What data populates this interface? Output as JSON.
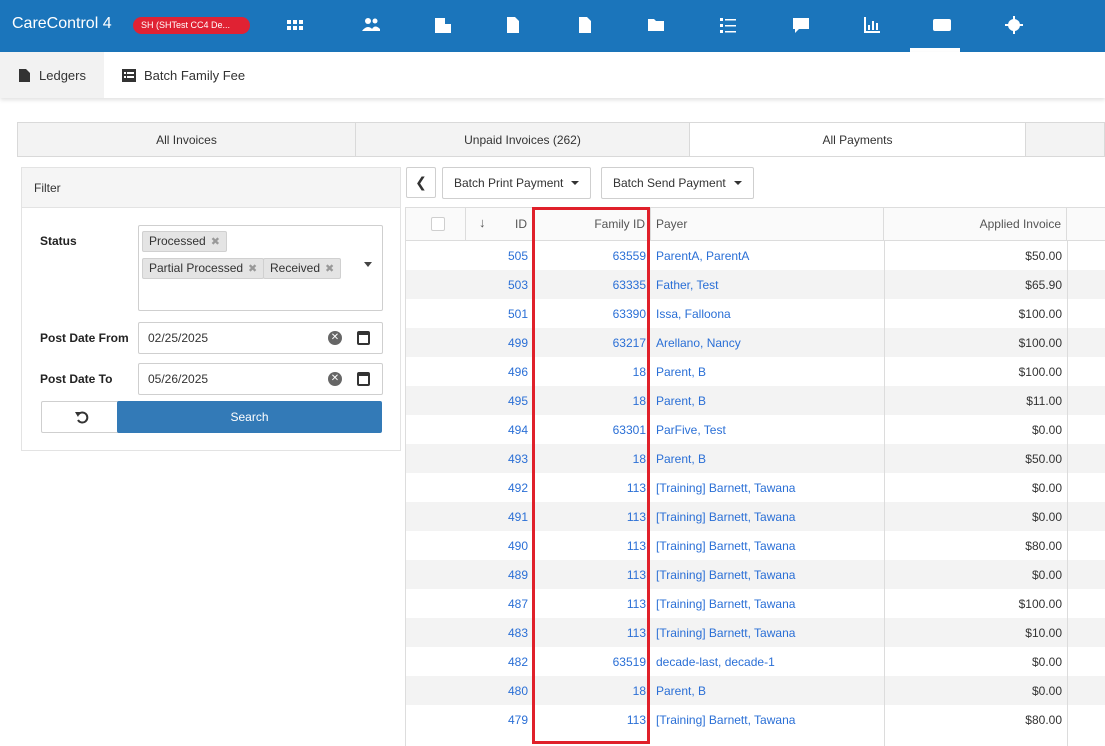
{
  "app": {
    "brand": "CareControl 4",
    "org_badge": "SH (SHTest CC4 De...",
    "nav_icons": [
      "apps-grid-icon",
      "people-icon",
      "building-icon",
      "invoice-icon",
      "report-doc-icon",
      "folder-icon",
      "checklist-icon",
      "chat-icon",
      "chart-icon",
      "billing-icon",
      "gear-icon"
    ],
    "colors": {
      "topbar": "#1b75bb",
      "badge": "#e02233",
      "link": "#2a6fd6",
      "primary_button": "#337ab7",
      "highlight": "#e0202a"
    }
  },
  "subnav": {
    "ledgers": "Ledgers",
    "batch_family_fee": "Batch Family Fee"
  },
  "tabs": {
    "all_invoices": "All Invoices",
    "unpaid_invoices": "Unpaid Invoices (262)",
    "all_payments": "All Payments"
  },
  "filter": {
    "title": "Filter",
    "status_label": "Status",
    "status_chips": [
      "Processed",
      "Partial Processed",
      "Received"
    ],
    "post_date_from_label": "Post Date From",
    "post_date_from": "02/25/2025",
    "post_date_to_label": "Post Date To",
    "post_date_to": "05/26/2025",
    "search_label": "Search"
  },
  "toolbar": {
    "batch_print": "Batch Print Payment",
    "batch_send": "Batch Send Payment"
  },
  "grid": {
    "columns": {
      "id": "ID",
      "family_id": "Family ID",
      "payer": "Payer",
      "applied_invoice": "Applied Invoice"
    },
    "rows": [
      {
        "id": "505",
        "family_id": "63559",
        "payer": "ParentA, ParentA",
        "applied": "$50.00"
      },
      {
        "id": "503",
        "family_id": "63335",
        "payer": "Father, Test",
        "applied": "$65.90"
      },
      {
        "id": "501",
        "family_id": "63390",
        "payer": "Issa, Falloona",
        "applied": "$100.00"
      },
      {
        "id": "499",
        "family_id": "63217",
        "payer": "Arellano, Nancy",
        "applied": "$100.00"
      },
      {
        "id": "496",
        "family_id": "18",
        "payer": "Parent, B",
        "applied": "$100.00"
      },
      {
        "id": "495",
        "family_id": "18",
        "payer": "Parent, B",
        "applied": "$11.00"
      },
      {
        "id": "494",
        "family_id": "63301",
        "payer": "ParFive, Test",
        "applied": "$0.00"
      },
      {
        "id": "493",
        "family_id": "18",
        "payer": "Parent, B",
        "applied": "$50.00"
      },
      {
        "id": "492",
        "family_id": "113",
        "payer": "[Training] Barnett, Tawana",
        "applied": "$0.00"
      },
      {
        "id": "491",
        "family_id": "113",
        "payer": "[Training] Barnett, Tawana",
        "applied": "$0.00"
      },
      {
        "id": "490",
        "family_id": "113",
        "payer": "[Training] Barnett, Tawana",
        "applied": "$80.00"
      },
      {
        "id": "489",
        "family_id": "113",
        "payer": "[Training] Barnett, Tawana",
        "applied": "$0.00"
      },
      {
        "id": "487",
        "family_id": "113",
        "payer": "[Training] Barnett, Tawana",
        "applied": "$100.00"
      },
      {
        "id": "483",
        "family_id": "113",
        "payer": "[Training] Barnett, Tawana",
        "applied": "$10.00"
      },
      {
        "id": "482",
        "family_id": "63519",
        "payer": "decade-last, decade-1",
        "applied": "$0.00"
      },
      {
        "id": "480",
        "family_id": "18",
        "payer": "Parent, B",
        "applied": "$0.00"
      },
      {
        "id": "479",
        "family_id": "113",
        "payer": "[Training] Barnett, Tawana",
        "applied": "$80.00"
      }
    ]
  }
}
